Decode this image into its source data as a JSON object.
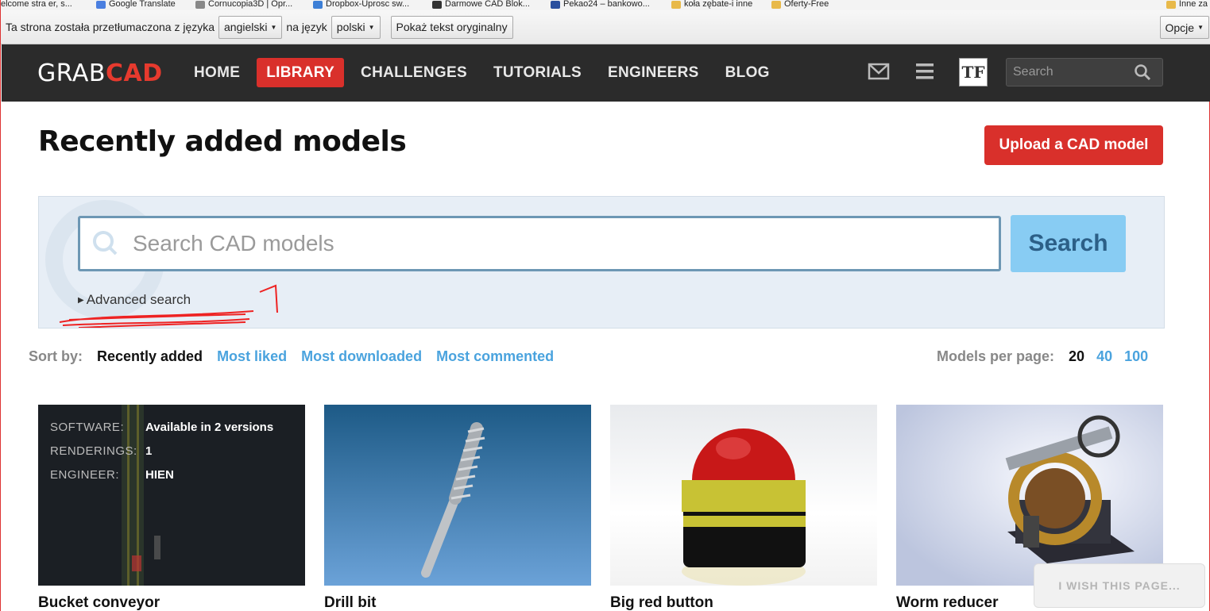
{
  "bookmarks": [
    {
      "label": "elcome stra   er, s...",
      "color": "#5a8ed8"
    },
    {
      "label": "Google Translate",
      "color": "#4a7fe0"
    },
    {
      "label": "Cornucopia3D | Opr...",
      "color": "#888888"
    },
    {
      "label": "Dropbox-Uprosc sw...",
      "color": "#3d7fd6"
    },
    {
      "label": "Darmowe CAD Blok...",
      "color": "#333333"
    },
    {
      "label": "Pekao24 – bankowo...",
      "color": "#2a4f9e"
    },
    {
      "label": "koła zębate-i inne",
      "color": "#e8b94a"
    },
    {
      "label": "Oferty-Free",
      "color": "#e8b94a"
    }
  ],
  "bookmarks_right": "Inne za",
  "translate": {
    "prefix": "Ta strona została przetłumaczona z języka",
    "from_lang": "angielski",
    "middle": "na język",
    "to_lang": "polski",
    "show_original": "Pokaż tekst oryginalny",
    "options": "Opcje"
  },
  "header": {
    "logo_grab": "GRAB",
    "logo_cad": "CAD",
    "nav": [
      "HOME",
      "LIBRARY",
      "CHALLENGES",
      "TUTORIALS",
      "ENGINEERS",
      "BLOG"
    ],
    "active_nav": "LIBRARY",
    "avatar_text": "TF",
    "search_placeholder": "Search"
  },
  "page": {
    "title": "Recently added models",
    "upload_label": "Upload a CAD model"
  },
  "search": {
    "placeholder": "Search CAD models",
    "button": "Search",
    "advanced": "Advanced search",
    "annotation": "1"
  },
  "sort": {
    "label": "Sort by:",
    "options": [
      "Recently added",
      "Most liked",
      "Most downloaded",
      "Most commented"
    ],
    "active": "Recently added"
  },
  "per_page": {
    "label": "Models per page:",
    "options": [
      "20",
      "40",
      "100"
    ],
    "active": "20"
  },
  "models": [
    {
      "title": "Bucket conveyor",
      "meta": [
        {
          "key": "SOFTWARE:",
          "value": "Available in 2 versions"
        },
        {
          "key": "RENDERINGS:",
          "value": "1"
        },
        {
          "key": "ENGINEER:",
          "value": "HIEN"
        }
      ]
    },
    {
      "title": "Drill bit"
    },
    {
      "title": "Big red button"
    },
    {
      "title": "Worm reducer"
    }
  ],
  "feedback": "I WISH THIS PAGE...",
  "colors": {
    "brand_red": "#d9302b",
    "link_blue": "#4aa3de",
    "header_bg": "#2b2b2b"
  }
}
